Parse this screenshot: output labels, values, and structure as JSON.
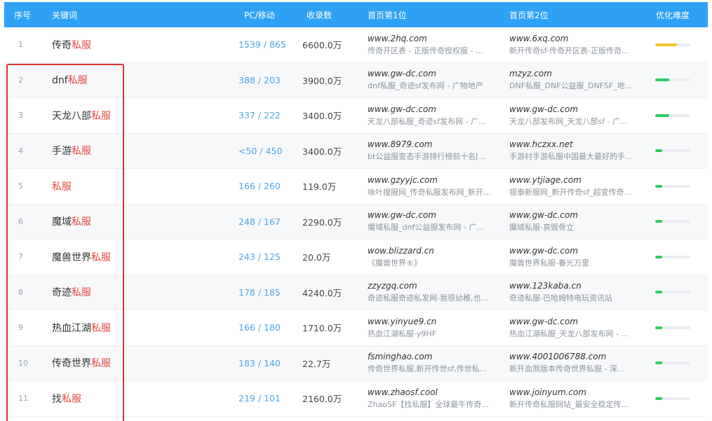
{
  "header": {
    "seq": "序号",
    "keyword": "关键词",
    "pc_mobile": "PC/移动",
    "indexed": "收录数",
    "first": "首页第1位",
    "second": "首页第2位",
    "difficulty": "优化难度"
  },
  "colors": {
    "header_bg": "#2ea1f5",
    "highlight": "#e8473f",
    "number_blue": "#4aa7e8",
    "bar_yellow": "#f4c22b",
    "bar_green": "#2ecc5e"
  },
  "rows": [
    {
      "seq": "1",
      "kw_pre": "传奇",
      "kw_red": "私服",
      "kw_post": "",
      "pc": "1539 / 865",
      "rec": "6600.0万",
      "p1_url": "www.2hq.com",
      "p1_desc": "传奇开区表 - 正版传奇授权服 - ...",
      "p2_url": "www.6xq.com",
      "p2_desc": "新开传奇sf-传奇开区表-正版传奇...",
      "difficulty": 0.62,
      "color": "#f4c22b"
    },
    {
      "seq": "2",
      "kw_pre": "dnf",
      "kw_red": "私服",
      "kw_post": "",
      "pc": "388 / 203",
      "rec": "3900.0万",
      "p1_url": "www.gw-dc.com",
      "p1_desc": "dnf私服_奇迹sf发布网 - 广物地产",
      "p2_url": "mzyz.com",
      "p2_desc": "DNF私服_DNF公益服_DNFSF_地...",
      "difficulty": 0.4,
      "color": "#2ecc5e"
    },
    {
      "seq": "3",
      "kw_pre": "天龙八部",
      "kw_red": "私服",
      "kw_post": "",
      "pc": "337 / 222",
      "rec": "3400.0万",
      "p1_url": "www.gw-dc.com",
      "p1_desc": "天龙八部私服_奇迹sf发布网 - 广...",
      "p2_url": "www.gw-dc.com",
      "p2_desc": "天龙八部发布网_天龙八部sf - 广...",
      "difficulty": 0.4,
      "color": "#2ecc5e"
    },
    {
      "seq": "4",
      "kw_pre": "手游",
      "kw_red": "私服",
      "kw_post": "",
      "pc": "<50 / 450",
      "rec": "3400.0万",
      "p1_url": "www.8979.com",
      "p1_desc": "bt公益服变态手游排行榜前十名[...",
      "p2_url": "www.hczxx.net",
      "p2_desc": "手游村手游私服中国最大最好的手...",
      "difficulty": 0.2,
      "color": "#2ecc5e"
    },
    {
      "seq": "5",
      "kw_pre": "",
      "kw_red": "私服",
      "kw_post": "",
      "pc": "166 / 260",
      "rec": "119.0万",
      "p1_url": "www.gzyyjc.com",
      "p1_desc": "咏叶搜服网_传奇私服发布网_新开...",
      "p2_url": "www.ytjiage.com",
      "p2_desc": "银泰新服网_新开传奇sf_超变传奇...",
      "difficulty": 0.2,
      "color": "#2ecc5e"
    },
    {
      "seq": "6",
      "kw_pre": "魔域",
      "kw_red": "私服",
      "kw_post": "",
      "pc": "248 / 167",
      "rec": "2290.0万",
      "p1_url": "www.gw-dc.com",
      "p1_desc": "魔域私服_dnf公益服发布网 - 广...",
      "p2_url": "www.gw-dc.com",
      "p2_desc": "魔域私服-哀毁骨立",
      "difficulty": 0.2,
      "color": "#2ecc5e"
    },
    {
      "seq": "7",
      "kw_pre": "魔兽世界",
      "kw_red": "私服",
      "kw_post": "",
      "pc": "243 / 125",
      "rec": "20.0万",
      "p1_url": "wow.blizzard.cn",
      "p1_desc": "《魔兽世界®》",
      "p2_url": "www.gw-dc.com",
      "p2_desc": "魔兽世界私服-春光万里",
      "difficulty": 0.2,
      "color": "#2ecc5e"
    },
    {
      "seq": "8",
      "kw_pre": "奇迹",
      "kw_red": "私服",
      "kw_post": "",
      "pc": "178 / 185",
      "rec": "4240.0万",
      "p1_url": "zzyzgq.com",
      "p1_desc": "奇迹私服奇迹私发网-我很幼稚,也...",
      "p2_url": "www.123kaba.cn",
      "p2_desc": "奇迹私服-巴哈姆特电玩资讯站",
      "difficulty": 0.2,
      "color": "#2ecc5e"
    },
    {
      "seq": "9",
      "kw_pre": "热血江湖",
      "kw_red": "私服",
      "kw_post": "",
      "pc": "166 / 180",
      "rec": "1710.0万",
      "p1_url": "www.yinyue9.cn",
      "p1_desc": "热血江湖私服-y9HF",
      "p2_url": "www.gw-dc.com",
      "p2_desc": "热血江湖私服_天龙八部发布网 - ...",
      "difficulty": 0.2,
      "color": "#2ecc5e"
    },
    {
      "seq": "10",
      "kw_pre": "传奇世界",
      "kw_red": "私服",
      "kw_post": "",
      "pc": "183 / 140",
      "rec": "22.7万",
      "p1_url": "fsminghao.com",
      "p1_desc": "传奇世界私服,新开传世sf,传世私...",
      "p2_url": "www.4001006788.com",
      "p2_desc": "新开血煞版本传奇世界私服 - 深...",
      "difficulty": 0.2,
      "color": "#2ecc5e"
    },
    {
      "seq": "11",
      "kw_pre": "找",
      "kw_red": "私服",
      "kw_post": "",
      "pc": "219 / 101",
      "rec": "2160.0万",
      "p1_url": "www.zhaosf.cool",
      "p1_desc": "ZhaoSF【找私服】全球最牛传奇...",
      "p2_url": "www.joinyum.com",
      "p2_desc": "新开传奇私服网站_最安全稳定传...",
      "difficulty": 0.2,
      "color": "#2ecc5e"
    }
  ]
}
